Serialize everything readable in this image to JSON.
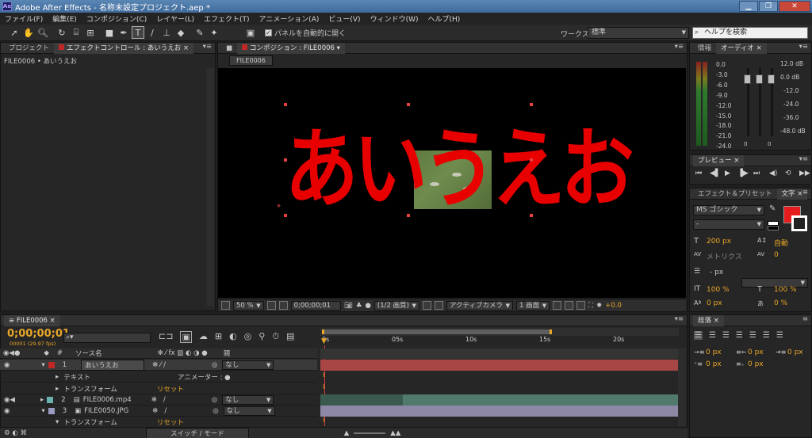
{
  "window": {
    "title": "Adobe After Effects - 名称未設定プロジェクト.aep *",
    "app_icon": "Ae"
  },
  "menu": [
    "ファイル(F)",
    "編集(E)",
    "コンポジション(C)",
    "レイヤー(L)",
    "エフェクト(T)",
    "アニメーション(A)",
    "ビュー(V)",
    "ウィンドウ(W)",
    "ヘルプ(H)"
  ],
  "toolbar": {
    "auto_open_label": "パネルを自動的に開く",
    "workspace_label": "ワークスペース：",
    "workspace_value": "標準",
    "help_placeholder": "ヘルプを検索"
  },
  "project_panel": {
    "tab_project": "プロジェクト",
    "tab_effects": "エフェクトコントロール : あいうえお",
    "path": "FILE0006 • あいうえお"
  },
  "comp_panel": {
    "tab": "コンポジション : FILE0006",
    "subtab": "FILE0006",
    "text": "あいうえお",
    "footer": {
      "zoom": "50 %",
      "timecode": "0;00;00;01",
      "resolution": "(1/2 画質)",
      "camera": "アクティブカメラ",
      "views": "1 画面",
      "exposure": "+0.0"
    }
  },
  "info_panel": {
    "tab_info": "情報",
    "tab_audio": "オーディオ",
    "left_scale": [
      "0.0",
      "-3.0",
      "-6.0",
      "-9.0",
      "-12.0",
      "-15.0",
      "-18.0",
      "-21.0",
      "-24.0"
    ],
    "right_scale": [
      "12.0 dB",
      "0.0 dB",
      "-12.0",
      "-24.0",
      "-36.0",
      "-48.0 dB"
    ],
    "bottom_left": "0",
    "bottom_right": "0"
  },
  "preview_panel": {
    "tab": "プレビュー"
  },
  "character_panel": {
    "tab_effects": "エフェクト＆プリセット",
    "tab_char": "文字",
    "font": "MS ゴシック",
    "style": "-",
    "size": "200 px",
    "leading": "自動",
    "kerning": "メトリクス",
    "tracking": "0",
    "stroke_unit": "- px",
    "vscale": "100 %",
    "hscale": "100 %",
    "baseline": "0 px",
    "tsume": "0 %",
    "fill_color": "#e61b1b"
  },
  "paragraph_panel": {
    "tab": "段落",
    "values": [
      "0 px",
      "0 px",
      "0 px",
      "0 px",
      "0 px"
    ]
  },
  "timeline": {
    "tab": "FILE0006",
    "timecode": "0;00;00;01",
    "frame_info": "00001 (29.97 fps)",
    "search_placeholder": "",
    "col_num": "#",
    "col_source": "ソース名",
    "col_parent": "親",
    "ruler": [
      "0s",
      "05s",
      "10s",
      "15s",
      "20s"
    ],
    "rows": [
      {
        "num": "1",
        "name": "あいうえお",
        "parent": "なし"
      },
      {
        "label": "テキスト",
        "extra": "アニメーター : ●"
      },
      {
        "label": "トランスフォーム",
        "extra": "リセット"
      },
      {
        "num": "2",
        "name": "FILE0006.mp4",
        "parent": "なし"
      },
      {
        "num": "3",
        "name": "FILE0050.JPG",
        "parent": "なし"
      },
      {
        "label": "トランスフォーム",
        "extra": "リセット"
      }
    ],
    "footer_label": "スイッチ / モード"
  }
}
